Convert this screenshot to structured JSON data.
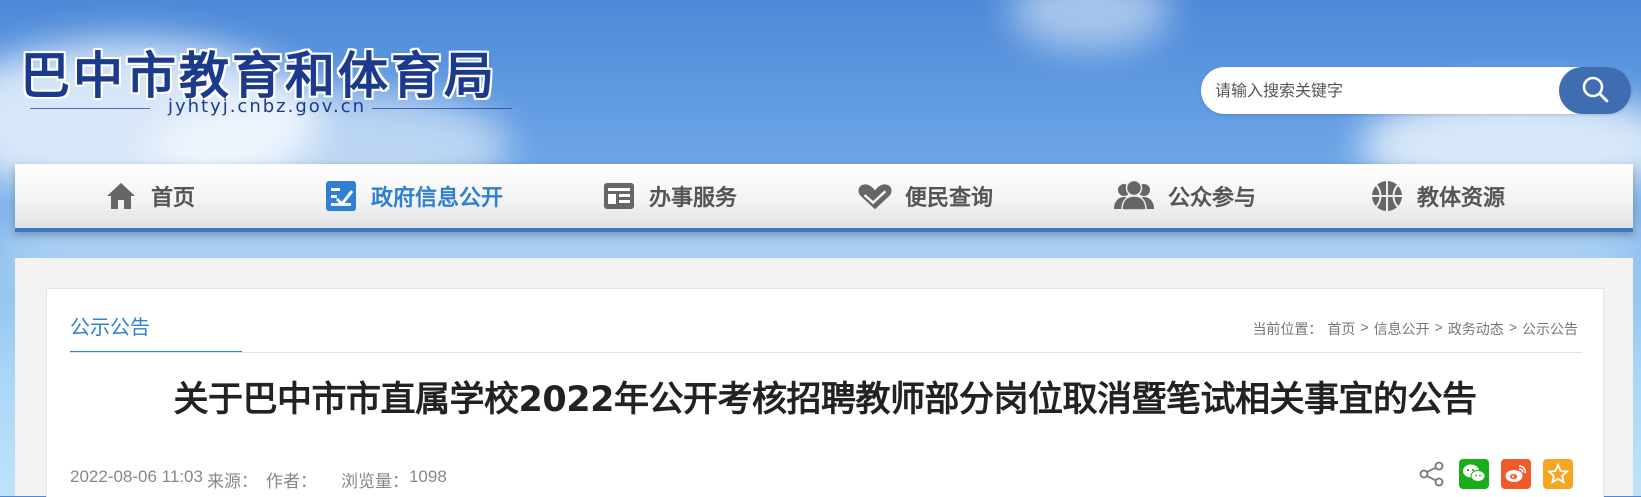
{
  "header": {
    "site_title": "巴中市教育和体育局",
    "site_domain": "jyhtyj.cnbz.gov.cn",
    "search": {
      "placeholder": "请输入搜索关键字",
      "icon": "search-icon"
    }
  },
  "nav": {
    "items": [
      {
        "label": "首页",
        "icon": "home-icon",
        "active": false
      },
      {
        "label": "政府信息公开",
        "icon": "checkbox-icon",
        "active": true
      },
      {
        "label": "办事服务",
        "icon": "service-card-icon",
        "active": false
      },
      {
        "label": "便民查询",
        "icon": "heart-hand-icon",
        "active": false
      },
      {
        "label": "公众参与",
        "icon": "users-icon",
        "active": false
      },
      {
        "label": "教体资源",
        "icon": "basketball-icon",
        "active": false
      }
    ],
    "active_color": "#2f7fd3"
  },
  "section": {
    "tab": "公示公告"
  },
  "breadcrumb": {
    "prefix": "当前位置：",
    "items": [
      "首页",
      "信息公开",
      "政务动态",
      "公示公告"
    ],
    "separator": ">"
  },
  "article": {
    "title": "关于巴中市市直属学校2022年公开考核招聘教师部分岗位取消暨笔试相关事宜的公告",
    "date": "2022-08-06 11:03",
    "source_label": "来源：",
    "author_label": "作者：",
    "views_label": "浏览量：",
    "views": "1098"
  },
  "share": {
    "icons": [
      "share-icon",
      "wechat-icon",
      "weibo-icon",
      "favorite-icon"
    ],
    "colors": {
      "wechat": "#1aad19",
      "weibo": "#f05a28",
      "favorite": "#f5a623"
    }
  }
}
